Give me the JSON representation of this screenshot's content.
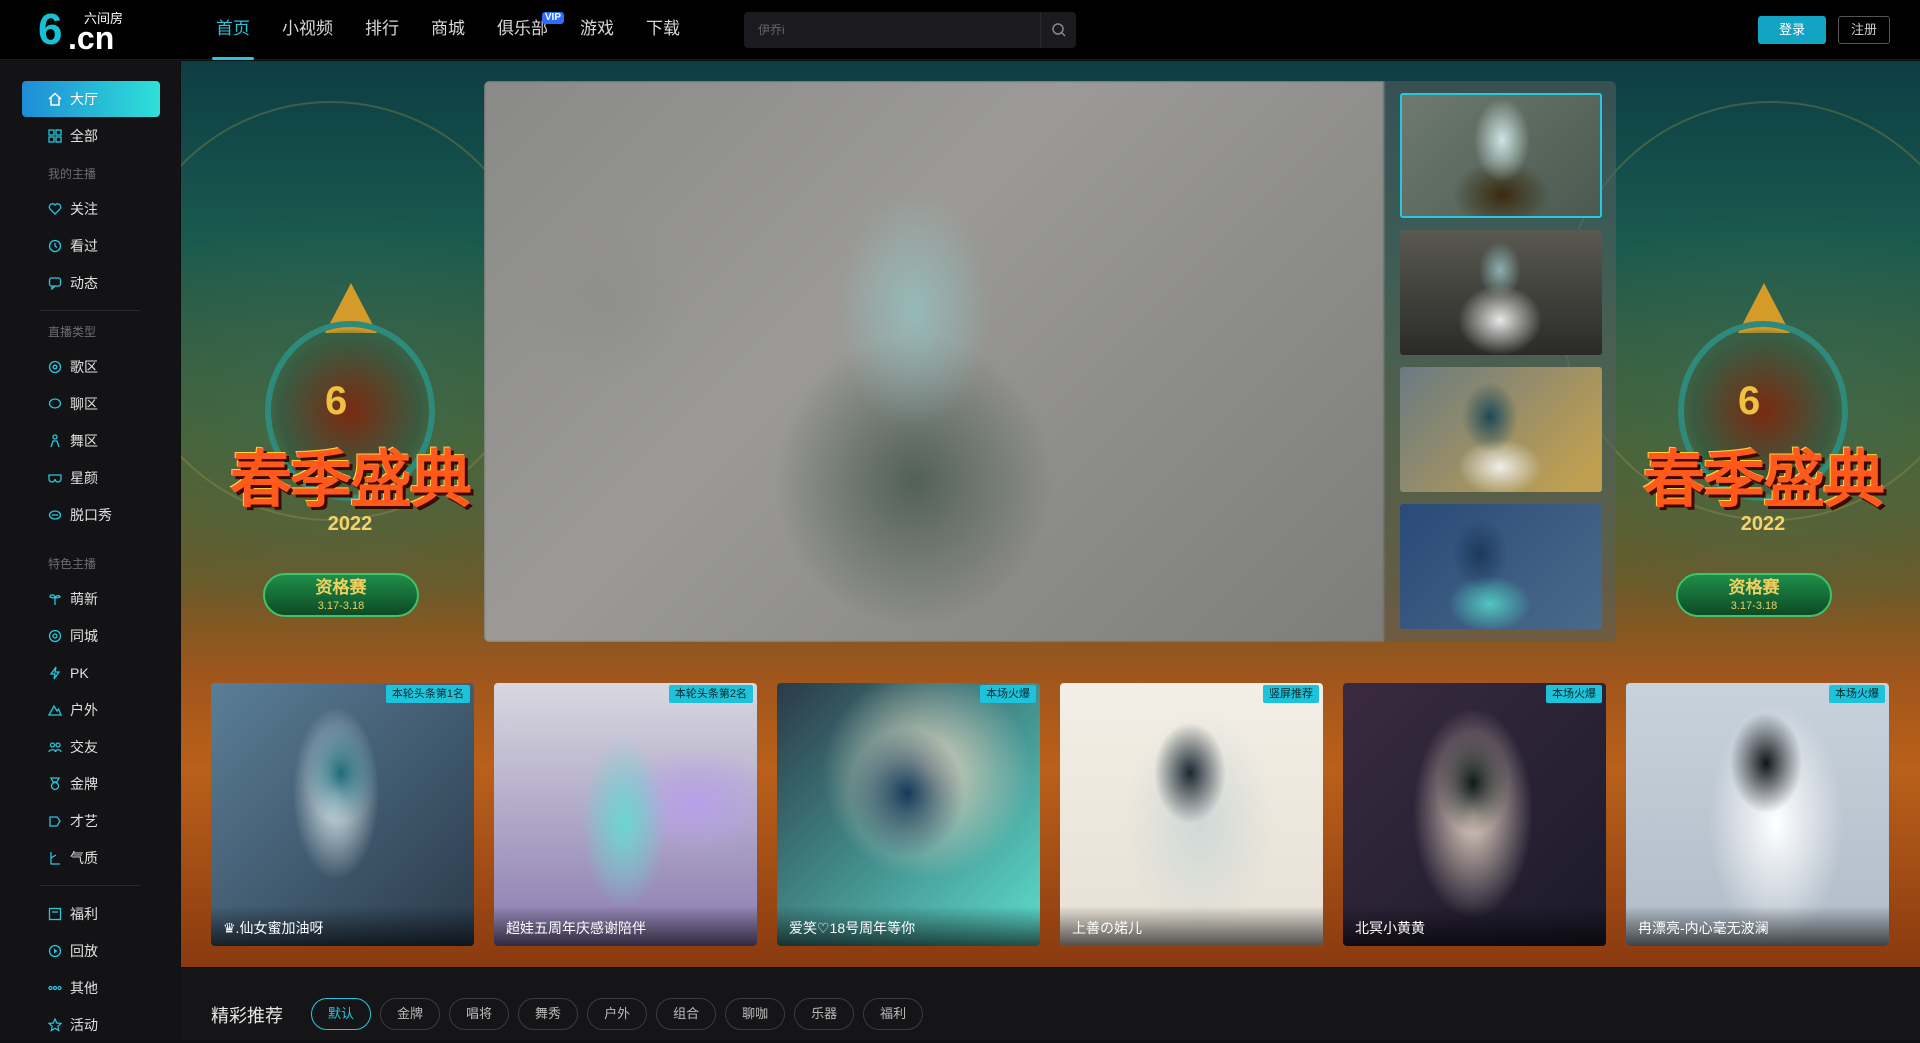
{
  "logo": {
    "brand": "6",
    "domain": ".cn",
    "subtitle": "六间房"
  },
  "nav": [
    {
      "label": "首页",
      "active": true
    },
    {
      "label": "小视频"
    },
    {
      "label": "排行"
    },
    {
      "label": "商城"
    },
    {
      "label": "俱乐部",
      "badge": "VIP"
    },
    {
      "label": "游戏"
    },
    {
      "label": "下载"
    }
  ],
  "search": {
    "placeholder": "伊乔i"
  },
  "auth": {
    "login": "登录",
    "register": "注册"
  },
  "sidebar": {
    "items": [
      {
        "label": "大厅",
        "icon": "home-icon",
        "active": true
      },
      {
        "label": "全部",
        "icon": "grid-icon"
      },
      {
        "label": "关注",
        "icon": "heart-icon"
      },
      {
        "label": "看过",
        "icon": "clock-icon"
      },
      {
        "label": "动态",
        "icon": "chat-icon"
      },
      {
        "label": "歌区",
        "icon": "music-icon"
      },
      {
        "label": "聊区",
        "icon": "chat-bubble-icon"
      },
      {
        "label": "舞区",
        "icon": "dancer-icon"
      },
      {
        "label": "星颜",
        "icon": "mask-icon"
      },
      {
        "label": "脱口秀",
        "icon": "mic-icon"
      },
      {
        "label": "萌新",
        "icon": "sprout-icon"
      },
      {
        "label": "同城",
        "icon": "location-icon"
      },
      {
        "label": "PK",
        "icon": "lightning-icon"
      },
      {
        "label": "户外",
        "icon": "mountain-icon"
      },
      {
        "label": "交友",
        "icon": "users-icon"
      },
      {
        "label": "金牌",
        "icon": "medal-icon"
      },
      {
        "label": "才艺",
        "icon": "palette-icon"
      },
      {
        "label": "气质",
        "icon": "dress-icon"
      },
      {
        "label": "福利",
        "icon": "gift-icon"
      },
      {
        "label": "回放",
        "icon": "replay-icon"
      },
      {
        "label": "其他",
        "icon": "more-icon"
      },
      {
        "label": "活动",
        "icon": "star-icon"
      }
    ],
    "groups": {
      "mine": "我的主播",
      "types": "直播类型",
      "featured": "特色主播"
    }
  },
  "banner": {
    "poster": {
      "title": "春季盛典",
      "year": "2022",
      "stage": "资格赛",
      "dates": "3.17-3.18"
    }
  },
  "cards": [
    {
      "tag": "本轮头条第1名",
      "name": "♛.仙女蜜加油呀"
    },
    {
      "tag": "本轮头条第2名",
      "name": "超娃五周年庆感谢陪伴"
    },
    {
      "tag": "本场火爆",
      "name": "爱笑♡18号周年等你"
    },
    {
      "tag": "竖屏推荐",
      "name": "上善の婼儿"
    },
    {
      "tag": "本场火爆",
      "name": "北冥小黄黄"
    },
    {
      "tag": "本场火爆",
      "name": "冉漂亮-内心毫无波澜"
    }
  ],
  "featured": {
    "title": "精彩推荐",
    "chips": [
      "默认",
      "金牌",
      "唱将",
      "舞秀",
      "户外",
      "组合",
      "聊咖",
      "乐器",
      "福利"
    ],
    "active_chip": "默认"
  },
  "colors": {
    "accent": "#25c8e0",
    "login_bg": "#13a4c4",
    "vip_badge": "#2f6bff"
  }
}
